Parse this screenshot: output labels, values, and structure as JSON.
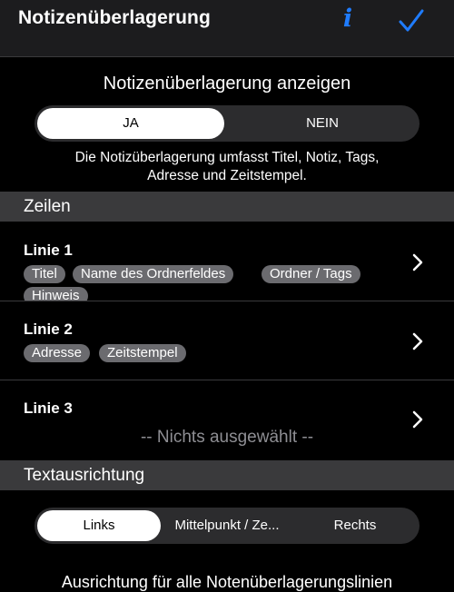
{
  "nav": {
    "title": "Notizenüberlagerung",
    "info_icon": "info-icon",
    "done_icon": "checkmark-icon",
    "accent_color": "#1f7cff"
  },
  "overlay": {
    "title": "Notizenüberlagerung anzeigen",
    "options": [
      "JA",
      "NEIN"
    ],
    "selected": "JA",
    "description_line1": "Die Notizüberlagerung umfasst Titel, Notiz, Tags,",
    "description_line2": "Adresse und Zeitstempel."
  },
  "sections": {
    "rows_header": "Zeilen",
    "alignment_header": "Textausrichtung"
  },
  "rows": [
    {
      "title": "Linie 1",
      "tags": [
        "Titel",
        "Name des Ordnerfeldes",
        "Ordner / Tags",
        "Hinweis"
      ]
    },
    {
      "title": "Linie 2",
      "tags": [
        "Adresse",
        "Zeitstempel"
      ]
    },
    {
      "title": "Linie 3",
      "placeholder": "-- Nichts ausgewählt --"
    }
  ],
  "alignment": {
    "options": [
      "Links",
      "Mittelpunkt / Ze...",
      "Rechts"
    ],
    "selected": "Links",
    "footer_text": "Ausrichtung für alle Notenüberlagerungslinien"
  }
}
